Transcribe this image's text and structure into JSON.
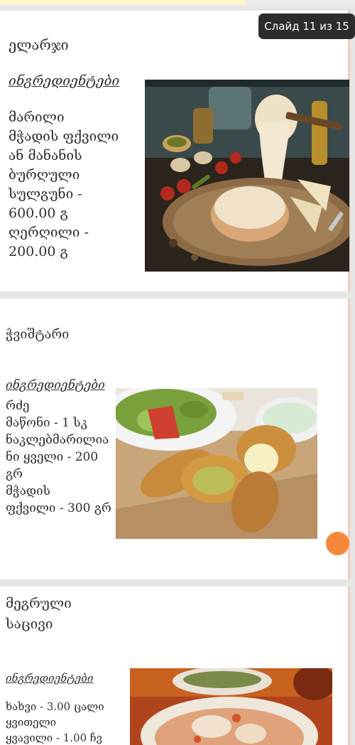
{
  "counter": {
    "label": "Слайд 11 из 15"
  },
  "slides": [
    {
      "title": [
        "ელარჯი"
      ],
      "ingredients_heading": "ინგრედიენტები",
      "ingredients": [
        "მარილი",
        "მჭადის ფქვილი",
        "ან მანანის",
        "ბურღული",
        "სულგუნი -",
        "600.00 გ",
        "ღერღილი -",
        "200.00 გ"
      ]
    },
    {
      "title": [
        "ჭვიშტარი"
      ],
      "ingredients_heading": "ინგრედიენტები",
      "ingredients": [
        "რძე",
        "მაწონი - 1 სკ",
        "ნაკლებმარილია",
        "ნი ყველი - 200",
        "გრ",
        "მჭადის",
        "ფქვილი - 300 გრ"
      ]
    },
    {
      "title": [
        "მეგრული",
        "საცივი"
      ],
      "ingredients_heading": "ინგრედიენტები",
      "ingredients": [
        "ხახვი - 3.00 ცალი",
        "ყვითელი",
        "ყვავილი - 1.00 ჩვ"
      ]
    }
  ],
  "colors": {
    "accent_fab": "#f5873a",
    "counter_bg": "#2c2c2c",
    "slide_bg": "#ffffff",
    "page_bg": "#e6e6e6"
  },
  "icons": {
    "scroll_fab": "orange-circle-button"
  }
}
